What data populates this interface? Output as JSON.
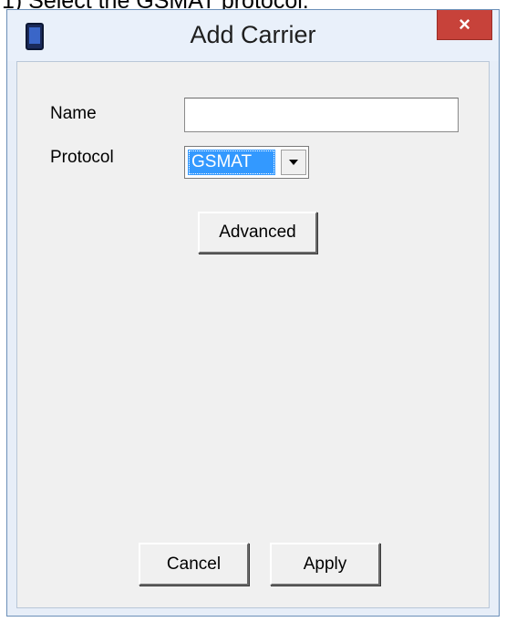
{
  "caption": "1) Select the GSMAT protocol.",
  "window": {
    "title": "Add Carrier",
    "close_glyph": "×"
  },
  "form": {
    "name_label": "Name",
    "name_value": "",
    "protocol_label": "Protocol",
    "protocol_selected": "GSMAT",
    "advanced_label": "Advanced"
  },
  "footer": {
    "cancel_label": "Cancel",
    "apply_label": "Apply"
  },
  "icons": {
    "app": "phone-icon",
    "dropdown": "chevron-down-icon"
  },
  "colors": {
    "selection": "#3399ff",
    "close": "#c7423a"
  }
}
